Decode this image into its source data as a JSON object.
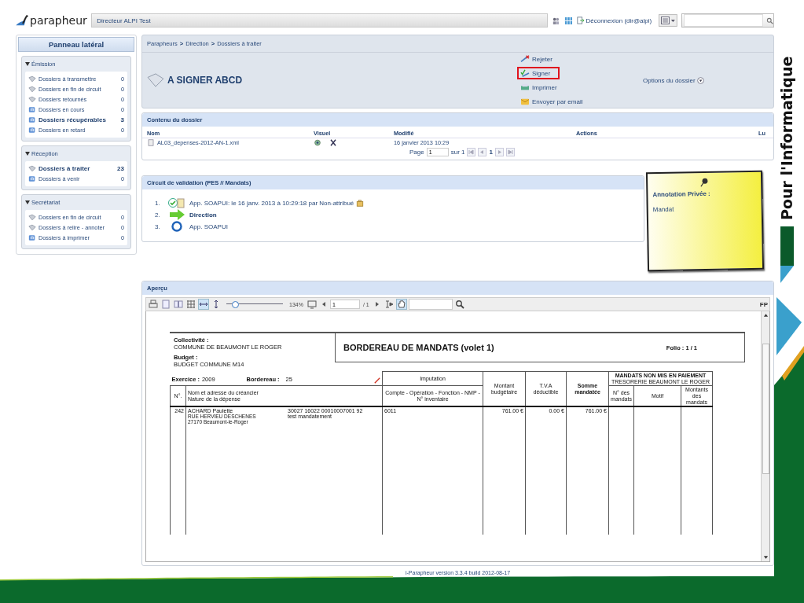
{
  "slide": {
    "side_text": "Pour l'Informatique"
  },
  "header": {
    "logo": "parapheur",
    "user": "Directeur ALPI Test",
    "logout": "Déconnexion (dir@alpi)"
  },
  "sidebar": {
    "title": "Panneau latéral",
    "sections": [
      {
        "title": "Émission",
        "expanded": true,
        "items": [
          {
            "label": "Dossiers à transmettre",
            "count": "0",
            "highlighted": false,
            "kind": "book"
          },
          {
            "label": "Dossiers en fin de circuit",
            "count": "0",
            "highlighted": false,
            "kind": "book"
          },
          {
            "label": "Dossiers retournés",
            "count": "0",
            "highlighted": false,
            "kind": "book"
          },
          {
            "label": "Dossiers en cours",
            "count": "0",
            "highlighted": false,
            "kind": "tray"
          },
          {
            "label": "Dossiers récupérables",
            "count": "3",
            "highlighted": true,
            "kind": "tray"
          },
          {
            "label": "Dossiers en retard",
            "count": "0",
            "highlighted": false,
            "kind": "tray"
          }
        ]
      },
      {
        "title": "Réception",
        "expanded": true,
        "items": [
          {
            "label": "Dossiers à traiter",
            "count": "23",
            "highlighted": true,
            "kind": "book"
          },
          {
            "label": "Dossiers à venir",
            "count": "0",
            "highlighted": false,
            "kind": "tray"
          }
        ]
      },
      {
        "title": "Secrétariat",
        "expanded": true,
        "items": [
          {
            "label": "Dossiers en fin de circuit",
            "count": "0",
            "highlighted": false,
            "kind": "book"
          },
          {
            "label": "Dossiers à relire - annoter",
            "count": "0",
            "highlighted": false,
            "kind": "book"
          },
          {
            "label": "Dossiers à imprimer",
            "count": "0",
            "highlighted": false,
            "kind": "tray"
          }
        ]
      }
    ]
  },
  "breadcrumb": {
    "separator": ">",
    "items": [
      "Parapheurs",
      "Direction",
      "Dossiers à traiter"
    ]
  },
  "dossier": {
    "title": "A SIGNER ABCD",
    "actions": [
      {
        "label": "Rejeter",
        "kind": "reject",
        "highlighted": false
      },
      {
        "label": "Signer",
        "kind": "sign",
        "highlighted": true
      },
      {
        "label": "Imprimer",
        "kind": "print",
        "highlighted": false
      },
      {
        "label": "Envoyer par email",
        "kind": "email",
        "highlighted": false
      }
    ],
    "options": "Options du dossier"
  },
  "contents": {
    "title": "Contenu du dossier",
    "columns": [
      "Nom",
      "Visuel",
      "Modifié",
      "Actions",
      "Lu"
    ],
    "rows": [
      {
        "name": "AL03_depenses-2012-AN-1.xml",
        "modified": "16 janvier 2013 10:29"
      }
    ],
    "pagination": {
      "label": "Page",
      "page": "1",
      "total": "sur 1",
      "current": "1"
    }
  },
  "circuit": {
    "title": "Circuit de validation (PES // Mandats)",
    "steps": [
      {
        "number": "1.",
        "kind": "done",
        "text": "App. SOAPUI: le 16 janv. 2013 à 10:29:18 par Non-attribué",
        "annotated": true
      },
      {
        "number": "2.",
        "kind": "current",
        "text": "Direction",
        "annotated": false
      },
      {
        "number": "3.",
        "kind": "pending",
        "text": "App. SOAPUI",
        "annotated": false
      }
    ]
  },
  "annotation": {
    "title": "Annotation Privée :",
    "text": "Mandat"
  },
  "preview": {
    "title": "Aperçu",
    "toolbar": {
      "tools_left": [
        {
          "kind": "print",
          "selected": false
        },
        {
          "kind": "single",
          "selected": false
        },
        {
          "kind": "double",
          "selected": false
        },
        {
          "kind": "thumbs",
          "selected": false
        },
        {
          "kind": "fitwidth",
          "selected": true
        },
        {
          "kind": "fitheight",
          "selected": false
        }
      ],
      "zoom": {
        "level": 0.15
      },
      "zoom_text": "134%",
      "page": "1",
      "total": "/ 1",
      "tools_right": [
        {
          "kind": "select",
          "selected": false
        },
        {
          "kind": "hand",
          "selected": true
        }
      ],
      "corner": "FP"
    },
    "document": {
      "collectivite_label": "Collectivité :",
      "collectivite": "COMMUNE DE BEAUMONT LE ROGER",
      "budget_label": "Budget :",
      "budget": "BUDGET COMMUNE M14",
      "title": "BORDEREAU DE MANDATS (volet 1)",
      "folio": "Folio : 1 / 1",
      "exercice_label": "Exercice :",
      "exercice": "2009",
      "bordereau_label": "Bordereau :",
      "bordereau": "25",
      "imputation": "Imputation",
      "imputation_sub": "Compte - Opération - Fonction - NMP - N° inventaire",
      "montant": "Montant budgétaire",
      "tva": "T.V.A déductible",
      "somme": "Somme mandatée",
      "nmp_title": "MANDATS NON MIS EN PAIEMENT",
      "nmp_sub": "TRESORERIE BEAUMONT LE ROGER",
      "no": "N°.",
      "creancier": "Nom et adresse du créancier",
      "nature": "Nature de la dépense",
      "n_mandats": "N° des mandats",
      "motif": "Motif",
      "montants": "Montants des mandats",
      "rows": [
        {
          "no": "242",
          "name": "ACHARD Paulette",
          "address": [
            "RUE HERVIEU DESCHENES",
            "27170 Beaumont-le-Roger"
          ],
          "bank": "30027 16022 00010007001 92",
          "nature": "test mandatement",
          "imputation": "6011",
          "montant": "761.00 €",
          "tva": "0.00 €",
          "somme": "761.00 €"
        }
      ]
    }
  },
  "footer": "i-Parapheur version 3.3.4 build 2012-08-17"
}
